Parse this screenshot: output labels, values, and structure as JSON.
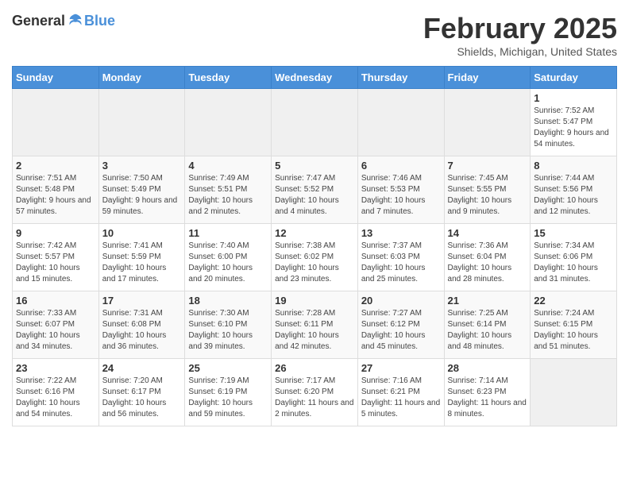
{
  "header": {
    "logo_general": "General",
    "logo_blue": "Blue",
    "title": "February 2025",
    "location": "Shields, Michigan, United States"
  },
  "days_of_week": [
    "Sunday",
    "Monday",
    "Tuesday",
    "Wednesday",
    "Thursday",
    "Friday",
    "Saturday"
  ],
  "weeks": [
    [
      {
        "day": "",
        "info": ""
      },
      {
        "day": "",
        "info": ""
      },
      {
        "day": "",
        "info": ""
      },
      {
        "day": "",
        "info": ""
      },
      {
        "day": "",
        "info": ""
      },
      {
        "day": "",
        "info": ""
      },
      {
        "day": "1",
        "info": "Sunrise: 7:52 AM\nSunset: 5:47 PM\nDaylight: 9 hours and 54 minutes."
      }
    ],
    [
      {
        "day": "2",
        "info": "Sunrise: 7:51 AM\nSunset: 5:48 PM\nDaylight: 9 hours and 57 minutes."
      },
      {
        "day": "3",
        "info": "Sunrise: 7:50 AM\nSunset: 5:49 PM\nDaylight: 9 hours and 59 minutes."
      },
      {
        "day": "4",
        "info": "Sunrise: 7:49 AM\nSunset: 5:51 PM\nDaylight: 10 hours and 2 minutes."
      },
      {
        "day": "5",
        "info": "Sunrise: 7:47 AM\nSunset: 5:52 PM\nDaylight: 10 hours and 4 minutes."
      },
      {
        "day": "6",
        "info": "Sunrise: 7:46 AM\nSunset: 5:53 PM\nDaylight: 10 hours and 7 minutes."
      },
      {
        "day": "7",
        "info": "Sunrise: 7:45 AM\nSunset: 5:55 PM\nDaylight: 10 hours and 9 minutes."
      },
      {
        "day": "8",
        "info": "Sunrise: 7:44 AM\nSunset: 5:56 PM\nDaylight: 10 hours and 12 minutes."
      }
    ],
    [
      {
        "day": "9",
        "info": "Sunrise: 7:42 AM\nSunset: 5:57 PM\nDaylight: 10 hours and 15 minutes."
      },
      {
        "day": "10",
        "info": "Sunrise: 7:41 AM\nSunset: 5:59 PM\nDaylight: 10 hours and 17 minutes."
      },
      {
        "day": "11",
        "info": "Sunrise: 7:40 AM\nSunset: 6:00 PM\nDaylight: 10 hours and 20 minutes."
      },
      {
        "day": "12",
        "info": "Sunrise: 7:38 AM\nSunset: 6:02 PM\nDaylight: 10 hours and 23 minutes."
      },
      {
        "day": "13",
        "info": "Sunrise: 7:37 AM\nSunset: 6:03 PM\nDaylight: 10 hours and 25 minutes."
      },
      {
        "day": "14",
        "info": "Sunrise: 7:36 AM\nSunset: 6:04 PM\nDaylight: 10 hours and 28 minutes."
      },
      {
        "day": "15",
        "info": "Sunrise: 7:34 AM\nSunset: 6:06 PM\nDaylight: 10 hours and 31 minutes."
      }
    ],
    [
      {
        "day": "16",
        "info": "Sunrise: 7:33 AM\nSunset: 6:07 PM\nDaylight: 10 hours and 34 minutes."
      },
      {
        "day": "17",
        "info": "Sunrise: 7:31 AM\nSunset: 6:08 PM\nDaylight: 10 hours and 36 minutes."
      },
      {
        "day": "18",
        "info": "Sunrise: 7:30 AM\nSunset: 6:10 PM\nDaylight: 10 hours and 39 minutes."
      },
      {
        "day": "19",
        "info": "Sunrise: 7:28 AM\nSunset: 6:11 PM\nDaylight: 10 hours and 42 minutes."
      },
      {
        "day": "20",
        "info": "Sunrise: 7:27 AM\nSunset: 6:12 PM\nDaylight: 10 hours and 45 minutes."
      },
      {
        "day": "21",
        "info": "Sunrise: 7:25 AM\nSunset: 6:14 PM\nDaylight: 10 hours and 48 minutes."
      },
      {
        "day": "22",
        "info": "Sunrise: 7:24 AM\nSunset: 6:15 PM\nDaylight: 10 hours and 51 minutes."
      }
    ],
    [
      {
        "day": "23",
        "info": "Sunrise: 7:22 AM\nSunset: 6:16 PM\nDaylight: 10 hours and 54 minutes."
      },
      {
        "day": "24",
        "info": "Sunrise: 7:20 AM\nSunset: 6:17 PM\nDaylight: 10 hours and 56 minutes."
      },
      {
        "day": "25",
        "info": "Sunrise: 7:19 AM\nSunset: 6:19 PM\nDaylight: 10 hours and 59 minutes."
      },
      {
        "day": "26",
        "info": "Sunrise: 7:17 AM\nSunset: 6:20 PM\nDaylight: 11 hours and 2 minutes."
      },
      {
        "day": "27",
        "info": "Sunrise: 7:16 AM\nSunset: 6:21 PM\nDaylight: 11 hours and 5 minutes."
      },
      {
        "day": "28",
        "info": "Sunrise: 7:14 AM\nSunset: 6:23 PM\nDaylight: 11 hours and 8 minutes."
      },
      {
        "day": "",
        "info": ""
      }
    ]
  ]
}
